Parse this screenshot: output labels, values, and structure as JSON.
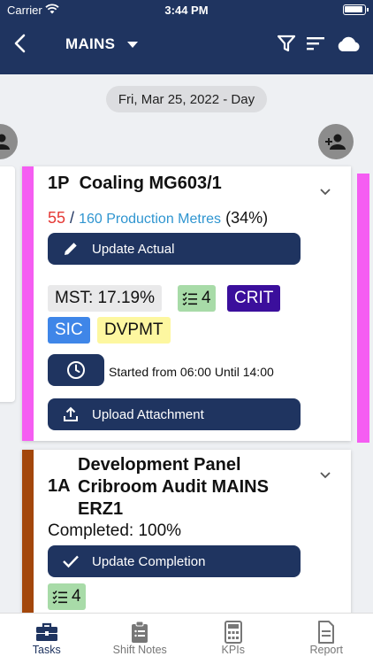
{
  "status_bar": {
    "carrier": "Carrier",
    "time": "3:44 PM"
  },
  "nav": {
    "title": "MAINS",
    "icons": [
      "back-icon",
      "filter-icon",
      "sort-icon",
      "cloud-icon"
    ]
  },
  "date_label": "Fri, Mar 25, 2022 - Day",
  "cards": [
    {
      "code": "1P",
      "title": "Coaling MG603/1",
      "stripe_color": "#f55df2",
      "actual": "55",
      "separator": "/",
      "planned": "160 Production Metres",
      "percent": "(34%)",
      "primary_button": "Update Actual",
      "chips": {
        "mst": "MST: 17.19%",
        "tasks": "4",
        "crit": "CRIT",
        "sic": "SIC",
        "dvpmt": "DVPMT"
      },
      "shift_text": "Started from 06:00 Until 14:00",
      "upload_button": "Upload Attachment"
    },
    {
      "code": "1A",
      "title_lines": [
        "Development Panel",
        "Cribroom Audit MAINS",
        "ERZ1"
      ],
      "stripe_color": "#a3470b",
      "completed_text": "Completed: 100%",
      "primary_button": "Update Completion",
      "chips": {
        "tasks": "4"
      }
    }
  ],
  "tabs": [
    {
      "label": "Tasks",
      "icon": "toolbox-icon",
      "active": true
    },
    {
      "label": "Shift Notes",
      "icon": "clipboard-icon",
      "active": false
    },
    {
      "label": "KPIs",
      "icon": "calculator-icon",
      "active": false
    },
    {
      "label": "Report",
      "icon": "document-icon",
      "active": false
    }
  ],
  "colors": {
    "header": "#1f3460",
    "accent_pink": "#f55df2",
    "accent_brown": "#a3470b",
    "crit": "#3b0f9c",
    "sic": "#3f86e8"
  }
}
